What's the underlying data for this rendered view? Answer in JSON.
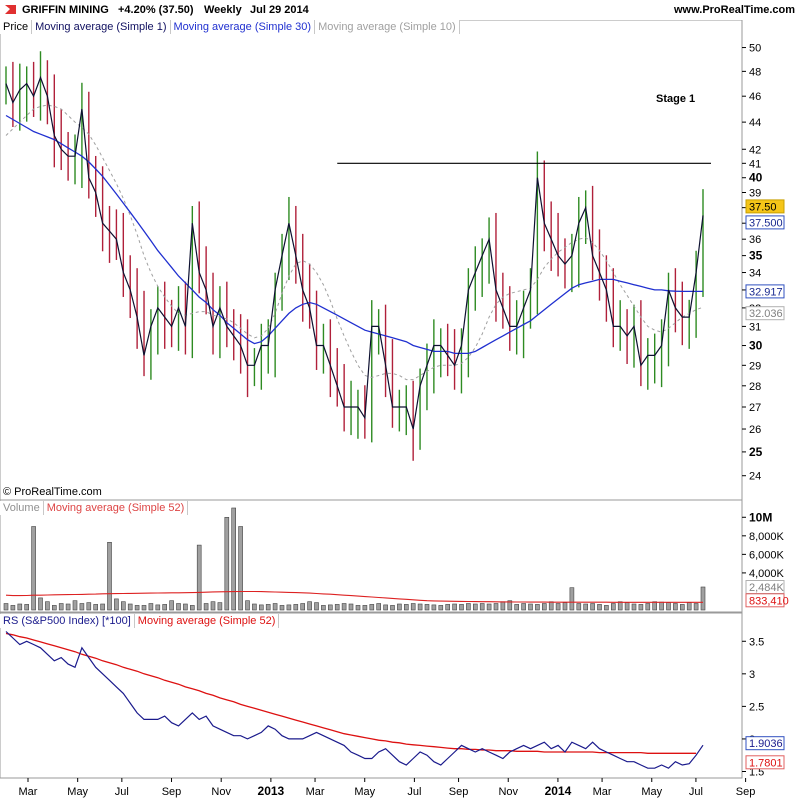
{
  "header": {
    "symbol": "GRIFFIN MINING",
    "change": "+4.20% (37.50)",
    "period": "Weekly",
    "date": "Jul 29 2014",
    "site": "www.ProRealTime.com"
  },
  "copyright": "© ProRealTime.com",
  "legends": {
    "price": [
      "Price",
      "Moving average (Simple 1)",
      "Moving average (Simple 30)",
      "Moving average (Simple 10)"
    ],
    "volume": [
      "Volume",
      "Moving average (Simple 52)"
    ],
    "rs": [
      "RS (S&P500 Index) [*100]",
      "Moving average (Simple 52)"
    ]
  },
  "colors": {
    "up": "#2e8b22",
    "down": "#b0203a",
    "close_line": "#0d1030",
    "ma30": "#2030d0",
    "ma10": "#a0a0a0",
    "rs_line": "#1a1a8c",
    "rs_ma": "#dd1111",
    "vol_ma": "#dd2222",
    "last_price_bg": "#f5c518"
  },
  "x_axis_labels": [
    "Mar",
    "May",
    "Jul",
    "Sep",
    "Nov",
    "2013",
    "Mar",
    "May",
    "Jul",
    "Sep",
    "Nov",
    "2014",
    "Mar",
    "May",
    "Jul",
    "Sep"
  ],
  "chart_data": [
    {
      "type": "line",
      "title": "Price",
      "annotation": "Stage 1",
      "resistance_level": 41,
      "y_scale": "log",
      "ylim": [
        23.5,
        51
      ],
      "y_ticks": [
        24,
        25,
        26,
        27,
        28,
        29,
        30,
        31,
        32,
        33,
        34,
        35,
        36,
        37,
        38,
        39,
        40,
        41,
        42,
        44,
        46,
        48,
        50
      ],
      "y_ticks_bold": [
        25,
        30,
        35,
        40
      ],
      "series": [
        {
          "name": "Moving average (Simple 1)",
          "values": [
            47,
            45.5,
            46.5,
            47,
            46,
            47.5,
            46,
            43,
            42,
            41.5,
            41.5,
            45,
            40,
            39,
            37,
            36.5,
            36,
            34,
            33,
            31.5,
            29.5,
            31,
            32,
            31.5,
            31,
            32,
            31,
            37,
            34,
            33,
            31,
            32,
            31,
            30.5,
            30,
            29,
            29,
            30,
            30,
            33,
            35,
            37,
            35,
            33,
            32,
            30,
            30,
            29,
            28,
            27,
            27,
            27,
            26.5,
            31,
            31,
            29,
            27,
            27,
            27,
            26,
            28,
            29,
            30,
            30,
            29.5,
            29,
            30,
            33,
            34,
            35,
            36,
            33,
            32,
            31,
            31,
            32,
            33,
            40,
            37,
            36,
            35,
            34.5,
            35,
            37,
            38,
            35,
            34,
            33,
            31,
            31,
            30.5,
            31,
            29,
            29.5,
            29.5,
            30,
            33,
            32,
            31.5,
            31.5,
            34,
            37.5
          ]
        },
        {
          "name": "Moving average (Simple 30)",
          "values": [
            44.5,
            44.2,
            43.9,
            43.6,
            43.3,
            43.1,
            42.9,
            42.7,
            42.4,
            42.1,
            41.8,
            41.5,
            41.1,
            40.6,
            40.1,
            39.5,
            38.9,
            38.3,
            37.7,
            37.1,
            36.5,
            35.9,
            35.3,
            34.8,
            34.3,
            33.8,
            33.4,
            33,
            32.6,
            32.3,
            31.9,
            31.6,
            31.2,
            30.9,
            30.6,
            30.3,
            30.1,
            30.2,
            30.5,
            30.9,
            31.3,
            31.7,
            32,
            32.2,
            32.3,
            32.2,
            32,
            31.8,
            31.6,
            31.4,
            31.2,
            31,
            30.8,
            30.7,
            30.6,
            30.5,
            30.4,
            30.3,
            30.2,
            30,
            29.9,
            29.8,
            29.7,
            29.7,
            29.7,
            29.6,
            29.6,
            29.6,
            29.7,
            29.9,
            30.1,
            30.3,
            30.5,
            30.7,
            30.9,
            31.1,
            31.3,
            31.6,
            31.9,
            32.2,
            32.5,
            32.8,
            33.1,
            33.3,
            33.4,
            33.5,
            33.6,
            33.6,
            33.6,
            33.5,
            33.4,
            33.3,
            33.2,
            33.1,
            33,
            33,
            32.95,
            32.93,
            32.92,
            32.92,
            32.92,
            32.917
          ]
        },
        {
          "name": "Moving average (Simple 10)",
          "values": [
            43,
            43.5,
            44,
            44.5,
            45,
            45.2,
            45.3,
            45.2,
            45,
            44.5,
            44,
            43.6,
            43.1,
            42.3,
            41.4,
            40.5,
            39.6,
            38.6,
            37.5,
            36.3,
            35,
            34,
            33.2,
            32.6,
            32.1,
            31.7,
            31.6,
            31.7,
            31.8,
            31.8,
            31.6,
            31.5,
            31.4,
            31.2,
            30.9,
            30.6,
            30.4,
            30.5,
            30.9,
            31.7,
            32.8,
            33.8,
            34.5,
            34.7,
            34.5,
            34,
            33.3,
            32.4,
            31.4,
            30.5,
            29.7,
            29,
            28.5,
            28.4,
            28.5,
            28.6,
            28.6,
            28.5,
            28.3,
            28.3,
            28.5,
            28.7,
            28.9,
            29,
            29,
            29,
            29.1,
            29.4,
            29.9,
            30.6,
            31.5,
            32.2,
            32.6,
            32.8,
            32.9,
            33,
            33.1,
            33.6,
            34.3,
            34.8,
            35.2,
            35.5,
            35.8,
            36,
            36.1,
            35.8,
            35.3,
            34.7,
            34,
            33.3,
            32.7,
            32.1,
            31.5,
            31,
            30.8,
            30.7,
            30.9,
            31.2,
            31.5,
            31.7,
            31.9,
            32.036
          ]
        }
      ],
      "last_values": {
        "close": 37.5,
        "ma30": 32.917,
        "ma10": 32.036
      }
    },
    {
      "type": "bar",
      "title": "Volume",
      "y_ticks": [
        "4,000K",
        "6,000K",
        "8,000K",
        "10M"
      ],
      "ylim": [
        0,
        11000
      ],
      "values": [
        700,
        500,
        650,
        600,
        9000,
        1300,
        900,
        500,
        700,
        650,
        1000,
        700,
        800,
        600,
        650,
        7300,
        1200,
        900,
        650,
        500,
        500,
        700,
        550,
        600,
        1000,
        700,
        650,
        500,
        7000,
        700,
        900,
        800,
        10000,
        11000,
        9000,
        1000,
        650,
        550,
        600,
        700,
        500,
        550,
        600,
        700,
        900,
        800,
        500,
        550,
        600,
        700,
        650,
        500,
        500,
        600,
        700,
        550,
        500,
        650,
        600,
        700,
        650,
        600,
        550,
        500,
        600,
        650,
        600,
        700,
        650,
        700,
        650,
        700,
        900,
        1000,
        600,
        700,
        650,
        600,
        700,
        900,
        700,
        800,
        2400,
        700,
        650,
        700,
        600,
        500,
        700,
        900,
        800,
        650,
        600,
        700,
        900,
        850,
        800,
        700,
        600,
        800,
        700,
        2484
      ],
      "ma52": [
        1600,
        1550,
        1550,
        1560,
        1600,
        1600,
        1620,
        1640,
        1650,
        1660,
        1670,
        1680,
        1700,
        1720,
        1750,
        1760,
        1770,
        1780,
        1790,
        1800,
        1810,
        1820,
        1830,
        1840,
        1850,
        1860,
        1870,
        1880,
        1900,
        1920,
        1950,
        1960,
        1970,
        1980,
        1990,
        2000,
        1990,
        1980,
        1960,
        1940,
        1920,
        1900,
        1880,
        1850,
        1820,
        1780,
        1740,
        1700,
        1650,
        1600,
        1550,
        1500,
        1450,
        1400,
        1350,
        1300,
        1250,
        1200,
        1150,
        1100,
        1050,
        1000,
        980,
        960,
        950,
        940,
        930,
        920,
        910,
        900,
        890,
        880,
        875,
        870,
        865,
        860,
        855,
        850,
        848,
        846,
        844,
        842,
        840,
        840,
        839,
        838,
        837,
        836,
        835,
        835,
        834,
        834,
        834,
        834,
        834,
        833,
        833,
        833,
        833,
        833,
        833,
        833.41
      ],
      "last_values": {
        "volume": "2,484K",
        "ma52": "833,410"
      }
    },
    {
      "type": "line",
      "title": "RS (S&P500 Index) [*100]",
      "ylim": [
        1.4,
        3.75
      ],
      "y_ticks": [
        1.5,
        2,
        2.5,
        3,
        3.5
      ],
      "series": [
        {
          "name": "RS (S&P500 Index) [*100]",
          "values": [
            3.65,
            3.55,
            3.45,
            3.5,
            3.45,
            3.4,
            3.3,
            3.2,
            3.25,
            3.15,
            3.1,
            3.4,
            3.25,
            3.1,
            3,
            2.9,
            2.8,
            2.7,
            2.55,
            2.4,
            2.3,
            2.3,
            2.3,
            2.35,
            2.25,
            2.2,
            2.3,
            2.4,
            2.3,
            2.35,
            2.2,
            2.15,
            2.1,
            2.05,
            2.05,
            2,
            2.05,
            2.1,
            2.2,
            2.15,
            2.05,
            2,
            2,
            2,
            2.05,
            2.1,
            2.05,
            2,
            1.95,
            1.9,
            1.8,
            1.75,
            1.7,
            1.7,
            1.8,
            1.85,
            1.75,
            1.65,
            1.6,
            1.7,
            1.8,
            1.75,
            1.65,
            1.6,
            1.7,
            1.8,
            1.9,
            1.85,
            1.8,
            1.85,
            1.8,
            1.75,
            1.7,
            1.8,
            1.85,
            1.9,
            1.85,
            1.9,
            1.95,
            1.85,
            1.9,
            1.8,
            1.95,
            1.9,
            1.85,
            1.95,
            1.85,
            1.8,
            1.75,
            1.7,
            1.65,
            1.65,
            1.6,
            1.55,
            1.55,
            1.6,
            1.55,
            1.65,
            1.6,
            1.62,
            1.75,
            1.9036
          ]
        },
        {
          "name": "Moving average (Simple 52)",
          "values": [
            3.62,
            3.6,
            3.57,
            3.55,
            3.52,
            3.49,
            3.46,
            3.43,
            3.4,
            3.37,
            3.34,
            3.3,
            3.27,
            3.24,
            3.2,
            3.17,
            3.14,
            3.1,
            3.07,
            3.04,
            3,
            2.97,
            2.94,
            2.9,
            2.87,
            2.84,
            2.8,
            2.77,
            2.74,
            2.7,
            2.67,
            2.63,
            2.6,
            2.57,
            2.53,
            2.5,
            2.47,
            2.44,
            2.41,
            2.38,
            2.35,
            2.32,
            2.29,
            2.26,
            2.23,
            2.2,
            2.17,
            2.14,
            2.11,
            2.08,
            2.06,
            2.04,
            2.02,
            2,
            1.98,
            1.97,
            1.95,
            1.94,
            1.92,
            1.91,
            1.9,
            1.89,
            1.88,
            1.87,
            1.86,
            1.85,
            1.85,
            1.84,
            1.84,
            1.83,
            1.83,
            1.82,
            1.82,
            1.82,
            1.81,
            1.81,
            1.81,
            1.81,
            1.8,
            1.8,
            1.8,
            1.8,
            1.8,
            1.8,
            1.8,
            1.8,
            1.79,
            1.79,
            1.79,
            1.79,
            1.79,
            1.79,
            1.79,
            1.78,
            1.78,
            1.78,
            1.78,
            1.78,
            1.78,
            1.78,
            1.7801
          ]
        }
      ],
      "last_values": {
        "rs": "1.9036",
        "ma52": "1.7801"
      }
    }
  ]
}
